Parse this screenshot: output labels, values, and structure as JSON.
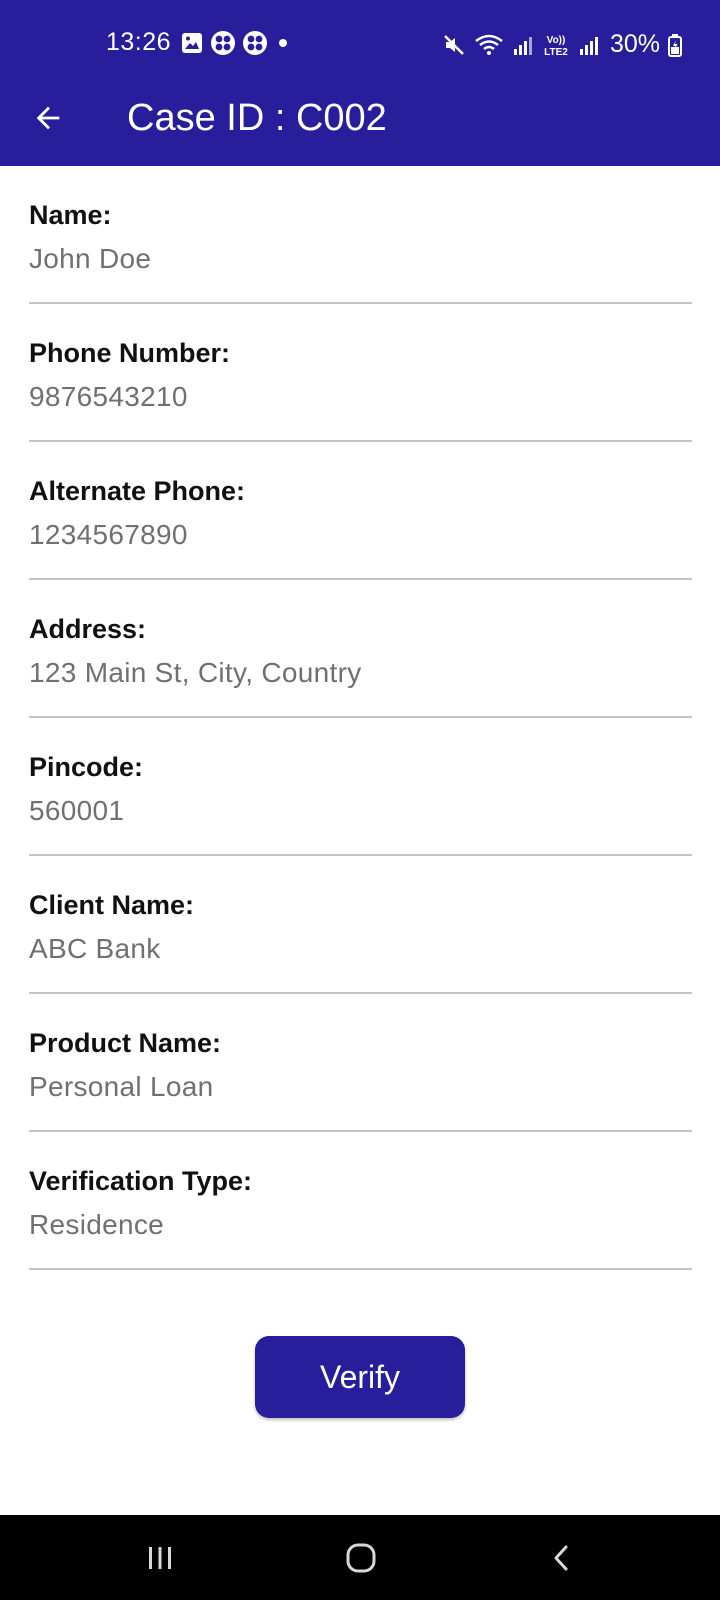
{
  "status_bar": {
    "time": "13:26",
    "battery": "30%",
    "left_icons": [
      "gallery-icon",
      "clover-icon",
      "clover-icon",
      "dot-icon"
    ],
    "right_icons": [
      "mute-icon",
      "wifi-icon",
      "signal-icon",
      "volte-icon",
      "signal-icon",
      "battery-icon"
    ]
  },
  "header": {
    "title": "Case ID : C002",
    "back_icon": "arrow-left-icon",
    "background_color": "#281e9c"
  },
  "fields": [
    {
      "label": "Name:",
      "value": "John Doe"
    },
    {
      "label": "Phone Number:",
      "value": "9876543210"
    },
    {
      "label": "Alternate Phone:",
      "value": "1234567890"
    },
    {
      "label": "Address:",
      "value": "123 Main St, City, Country"
    },
    {
      "label": "Pincode:",
      "value": "560001"
    },
    {
      "label": "Client Name:",
      "value": "ABC Bank"
    },
    {
      "label": "Product Name:",
      "value": "Personal Loan"
    },
    {
      "label": "Verification Type:",
      "value": "Residence"
    }
  ],
  "actions": {
    "verify_label": "Verify"
  },
  "nav_bar": {
    "buttons": [
      "recents-icon",
      "home-icon",
      "back-icon"
    ]
  }
}
